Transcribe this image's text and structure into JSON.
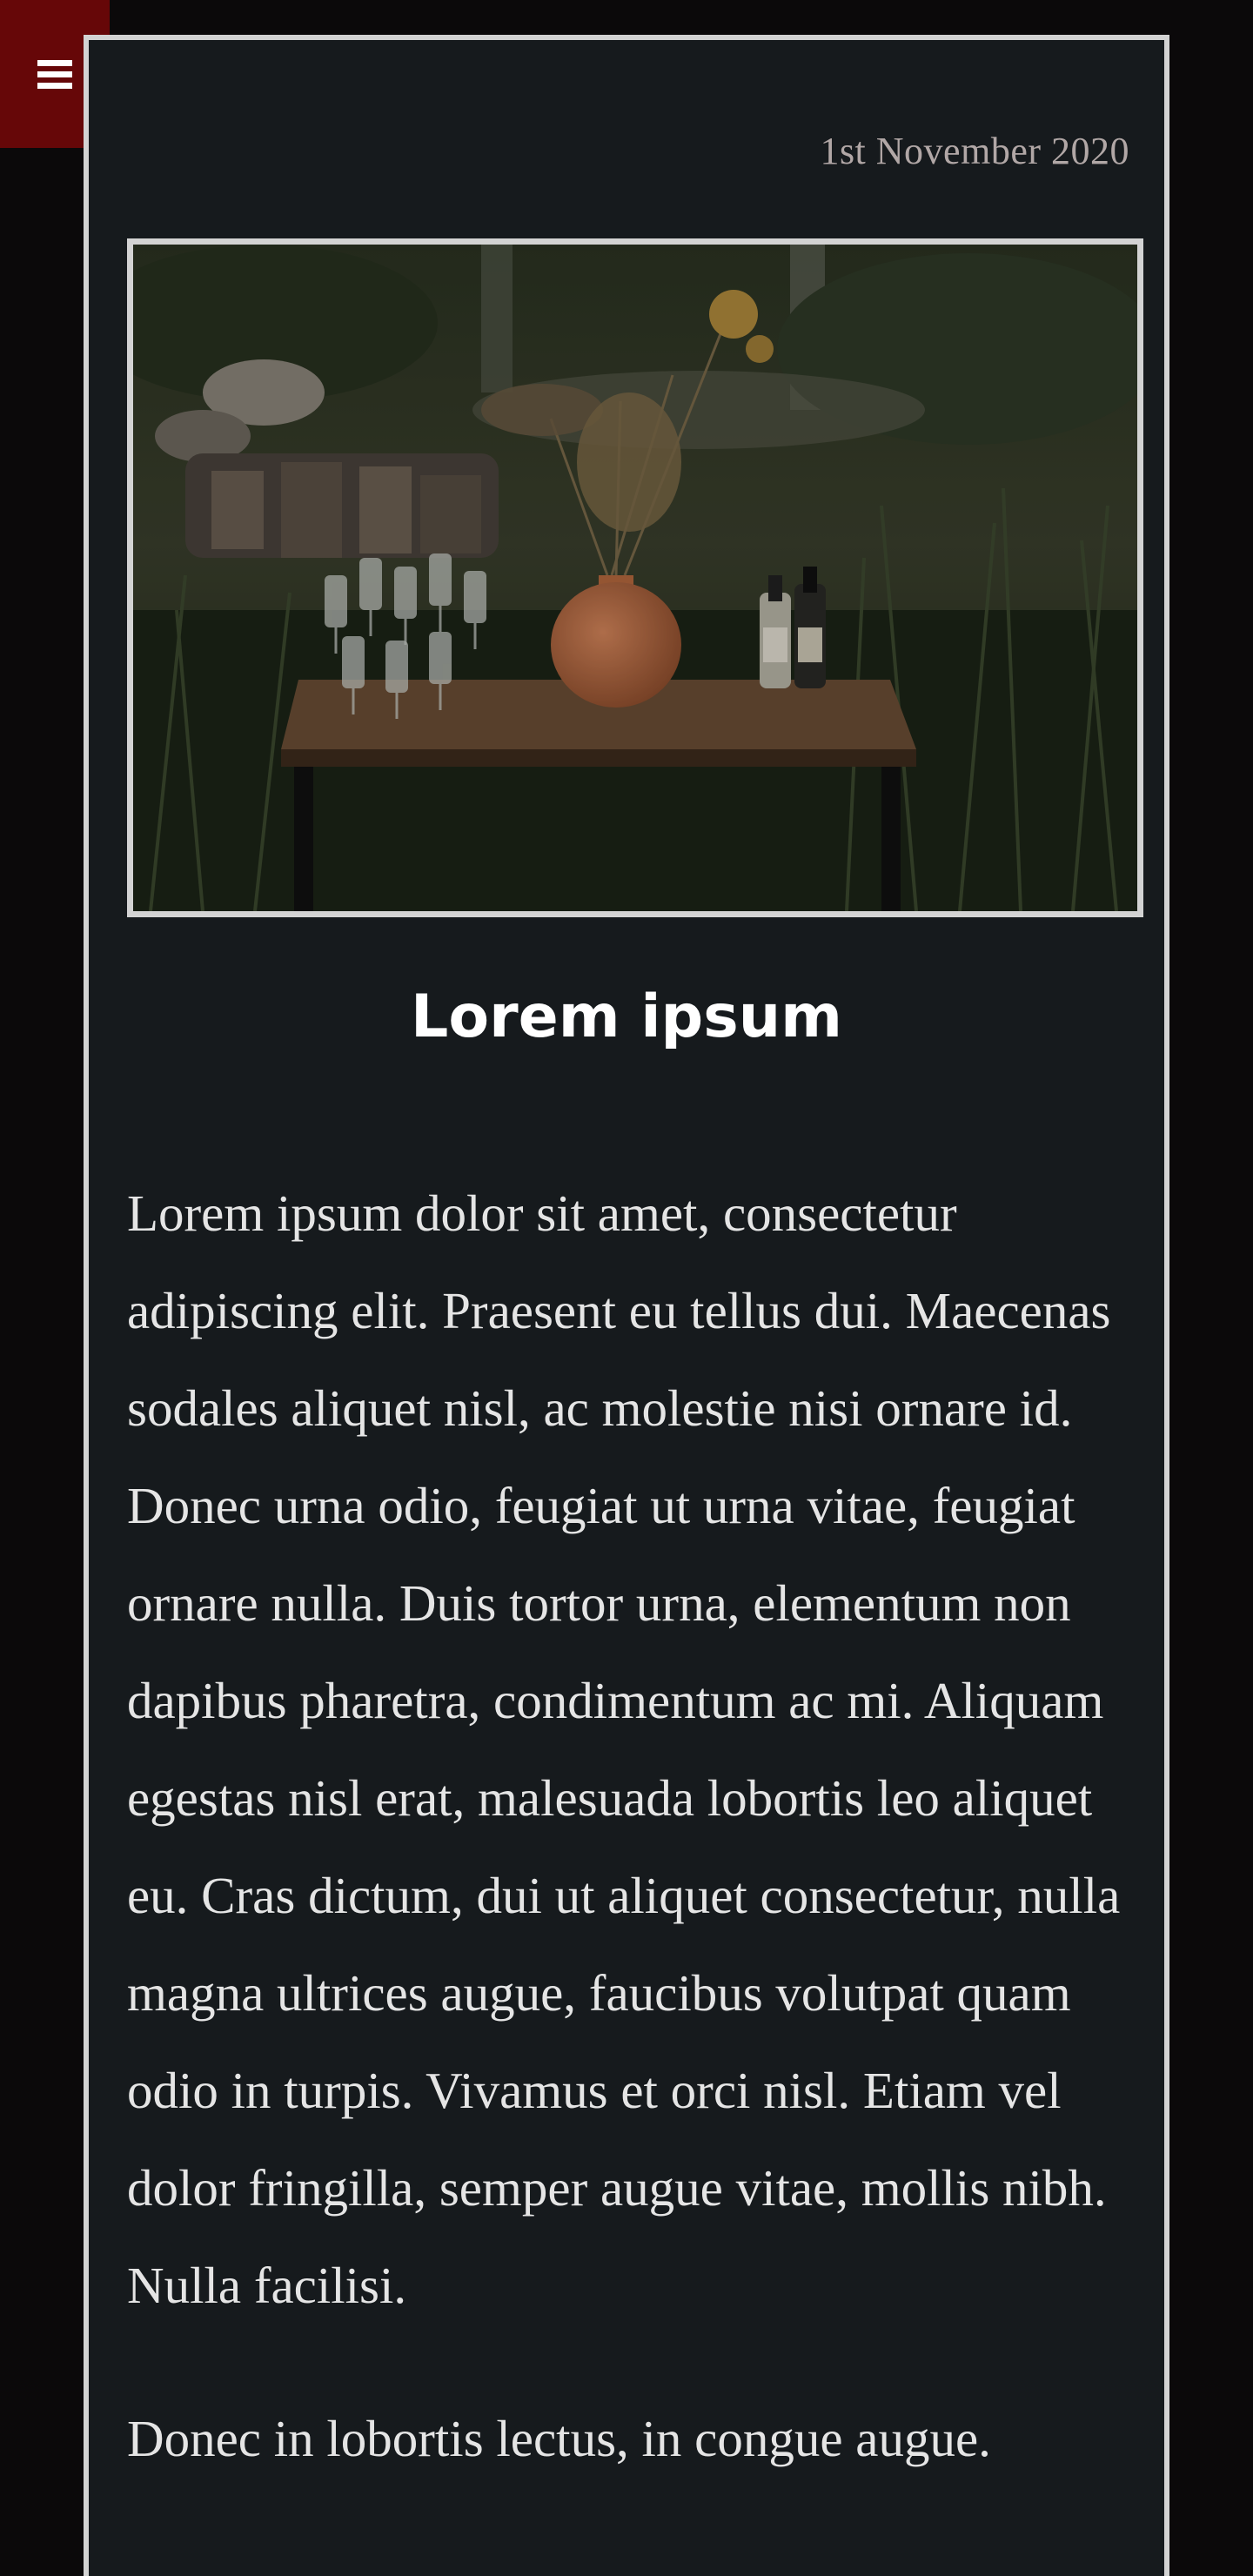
{
  "nav": {
    "menu_icon": "hamburger-menu-icon",
    "menu_glyph": "≡"
  },
  "post": {
    "date": "1st November 2020",
    "image_alt": "Table with vase, champagne glasses and bottles in a grassy field",
    "title": "Lorem ipsum",
    "paragraphs": [
      "Lorem ipsum dolor sit amet, consectetur adipiscing elit. Praesent eu tellus dui. Maecenas sodales aliquet nisl, ac molestie nisi ornare id. Donec urna odio, feugiat ut urna vitae, feugiat ornare nulla. Duis tortor urna, elementum non dapibus pharetra, condimentum ac mi. Aliquam egestas nisl erat, malesuada lobortis leo aliquet eu. Cras dictum, dui ut aliquet consectetur, nulla magna ultrices augue, faucibus volutpat quam odio in turpis. Vivamus et orci nisl. Etiam vel dolor fringilla, semper augue vitae, mollis nibh. Nulla facilisi.",
      "Donec in lobortis lectus, in congue augue."
    ]
  },
  "colors": {
    "page_background": "#0b090a",
    "card_background": "#161a1d",
    "menu_button": "#660708",
    "border": "#d3d3d3",
    "date_text": "#b1a7a6",
    "body_text": "#e5e5e5"
  }
}
